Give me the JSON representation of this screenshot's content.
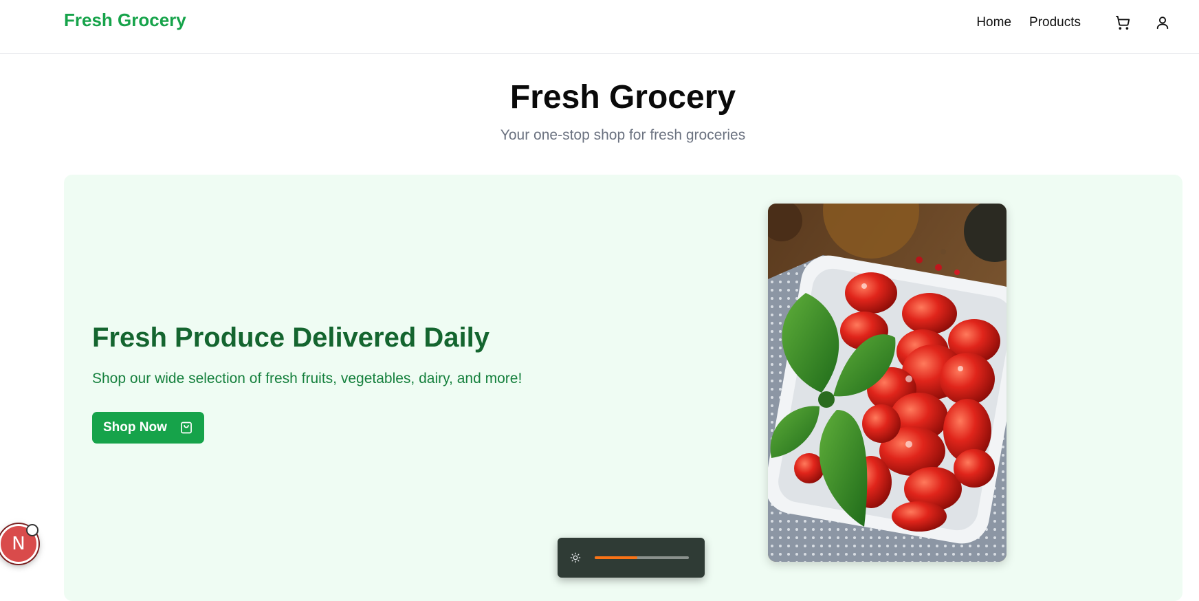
{
  "header": {
    "brand": "Fresh Grocery",
    "nav": [
      {
        "label": "Home"
      },
      {
        "label": "Products"
      }
    ],
    "icons": [
      "cart-icon",
      "user-icon"
    ]
  },
  "page": {
    "title": "Fresh Grocery",
    "subtitle": "Your one-stop shop for fresh groceries"
  },
  "hero": {
    "heading": "Fresh Produce Delivered Daily",
    "text": "Shop our wide selection of fresh fruits, vegetables, dairy, and more!",
    "button_label": "Shop Now",
    "button_icon": "shopping-bag-icon",
    "image_subject": "tomatoes-with-basil"
  },
  "brightness_control": {
    "icon": "sun-icon",
    "level": 0.45
  },
  "badge": {
    "letter": "N"
  },
  "colors": {
    "brand": "#16a34a",
    "hero_bg": "#effcf3",
    "hero_heading": "#14652f",
    "accent_slider": "#f97316"
  }
}
